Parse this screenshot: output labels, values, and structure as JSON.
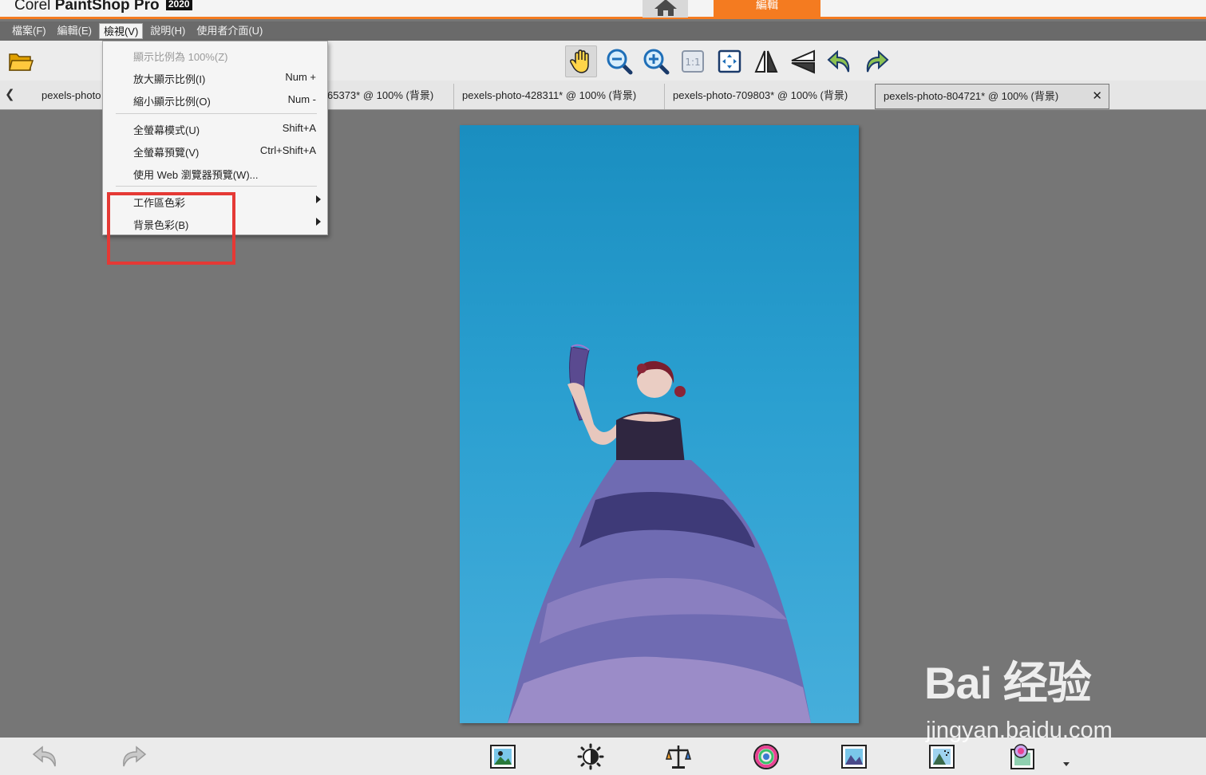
{
  "app": {
    "brand": "Corel",
    "product": "PaintShop Pro",
    "version": "2020",
    "edit_tab": "編輯",
    "accent_color": "#f47b20"
  },
  "menubar": {
    "items": [
      "檔案(F)",
      "編輯(E)",
      "檢視(V)",
      "說明(H)",
      "使用者介面(U)"
    ],
    "active_index": 2
  },
  "toolbar": {
    "icons": [
      "open-folder-icon",
      "pan-hand-icon",
      "zoom-out-icon",
      "zoom-in-icon",
      "actual-size-icon",
      "fit-to-window-icon",
      "flip-icon",
      "mirror-icon",
      "rotate-left-icon",
      "rotate-right-icon"
    ]
  },
  "tabs": {
    "items": [
      {
        "label": "pexels-photo"
      },
      {
        "label": "65373* @ 100% (背景)"
      },
      {
        "label": "pexels-photo-428311* @ 100% (背景)"
      },
      {
        "label": "pexels-photo-709803* @ 100% (背景)"
      },
      {
        "label": "pexels-photo-804721* @ 100% (背景)",
        "close": "✕"
      }
    ],
    "active_index": 4
  },
  "view_menu": {
    "items": [
      {
        "label": "顯示比例為 100%(Z)",
        "shortcut": "",
        "disabled": true
      },
      {
        "label": "放大顯示比例(I)",
        "shortcut": "Num +"
      },
      {
        "label": "縮小顯示比例(O)",
        "shortcut": "Num -"
      },
      {
        "label": "全螢幕模式(U)",
        "shortcut": "Shift+A"
      },
      {
        "label": "全螢幕預覽(V)",
        "shortcut": "Ctrl+Shift+A"
      },
      {
        "label": "使用 Web 瀏覽器預覽(W)...",
        "shortcut": ""
      },
      {
        "label": "工作區色彩",
        "shortcut": "",
        "submenu": true
      },
      {
        "label": "背景色彩(B)",
        "shortcut": "",
        "submenu": true
      }
    ],
    "highlight_color": "#e53935"
  },
  "bottombar": {
    "icons": [
      "undo-icon",
      "redo-icon",
      "smart-photo-fix-icon",
      "brightness-icon",
      "color-balance-icon",
      "saturation-icon",
      "photo-adjust-icon",
      "noise-removal-icon",
      "depth-of-field-icon"
    ]
  },
  "watermark": {
    "logo": "Bai 经验",
    "url": "jingyan.baidu.com"
  }
}
